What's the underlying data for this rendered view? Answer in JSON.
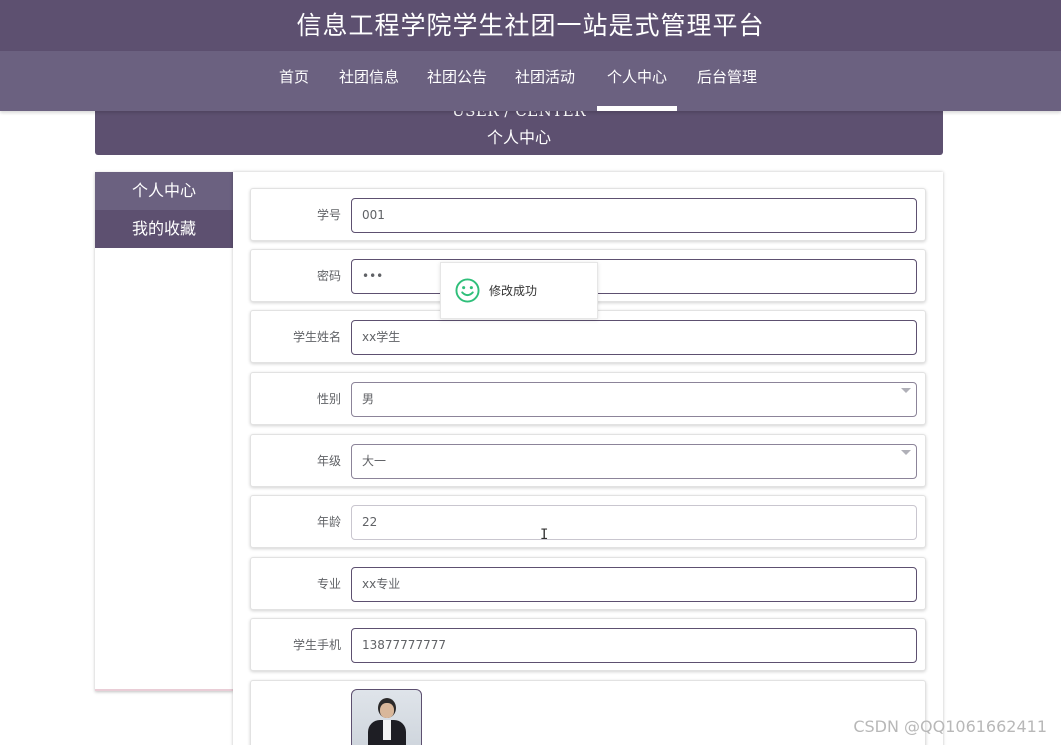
{
  "header": {
    "site_title": "信息工程学院学生社团一站是式管理平台",
    "nav": [
      {
        "label": "首页"
      },
      {
        "label": "社团信息"
      },
      {
        "label": "社团公告"
      },
      {
        "label": "社团活动"
      },
      {
        "label": "个人中心",
        "active": true
      },
      {
        "label": "后台管理"
      }
    ]
  },
  "banner": {
    "en_title": "USER / CENTER",
    "cn_title": "个人中心"
  },
  "sidebar": {
    "items": [
      {
        "label": "个人中心"
      },
      {
        "label": "我的收藏"
      }
    ]
  },
  "form": {
    "fields": [
      {
        "label": "学号",
        "value": "001"
      },
      {
        "label": "密码",
        "value": "•••"
      },
      {
        "label": "学生姓名",
        "value": "xx学生"
      },
      {
        "label": "性别",
        "value": "男"
      },
      {
        "label": "年级",
        "value": "大一"
      },
      {
        "label": "年龄",
        "value": "22"
      },
      {
        "label": "专业",
        "value": "xx专业"
      },
      {
        "label": "学生手机",
        "value": "13877777777"
      }
    ]
  },
  "toast": {
    "message": "修改成功",
    "icon": "smile-icon"
  },
  "watermark": "CSDN @QQ1061662411",
  "colors": {
    "primary": "#5d5070",
    "nav_bg": "#6b6180",
    "success": "#2fbf7a"
  }
}
